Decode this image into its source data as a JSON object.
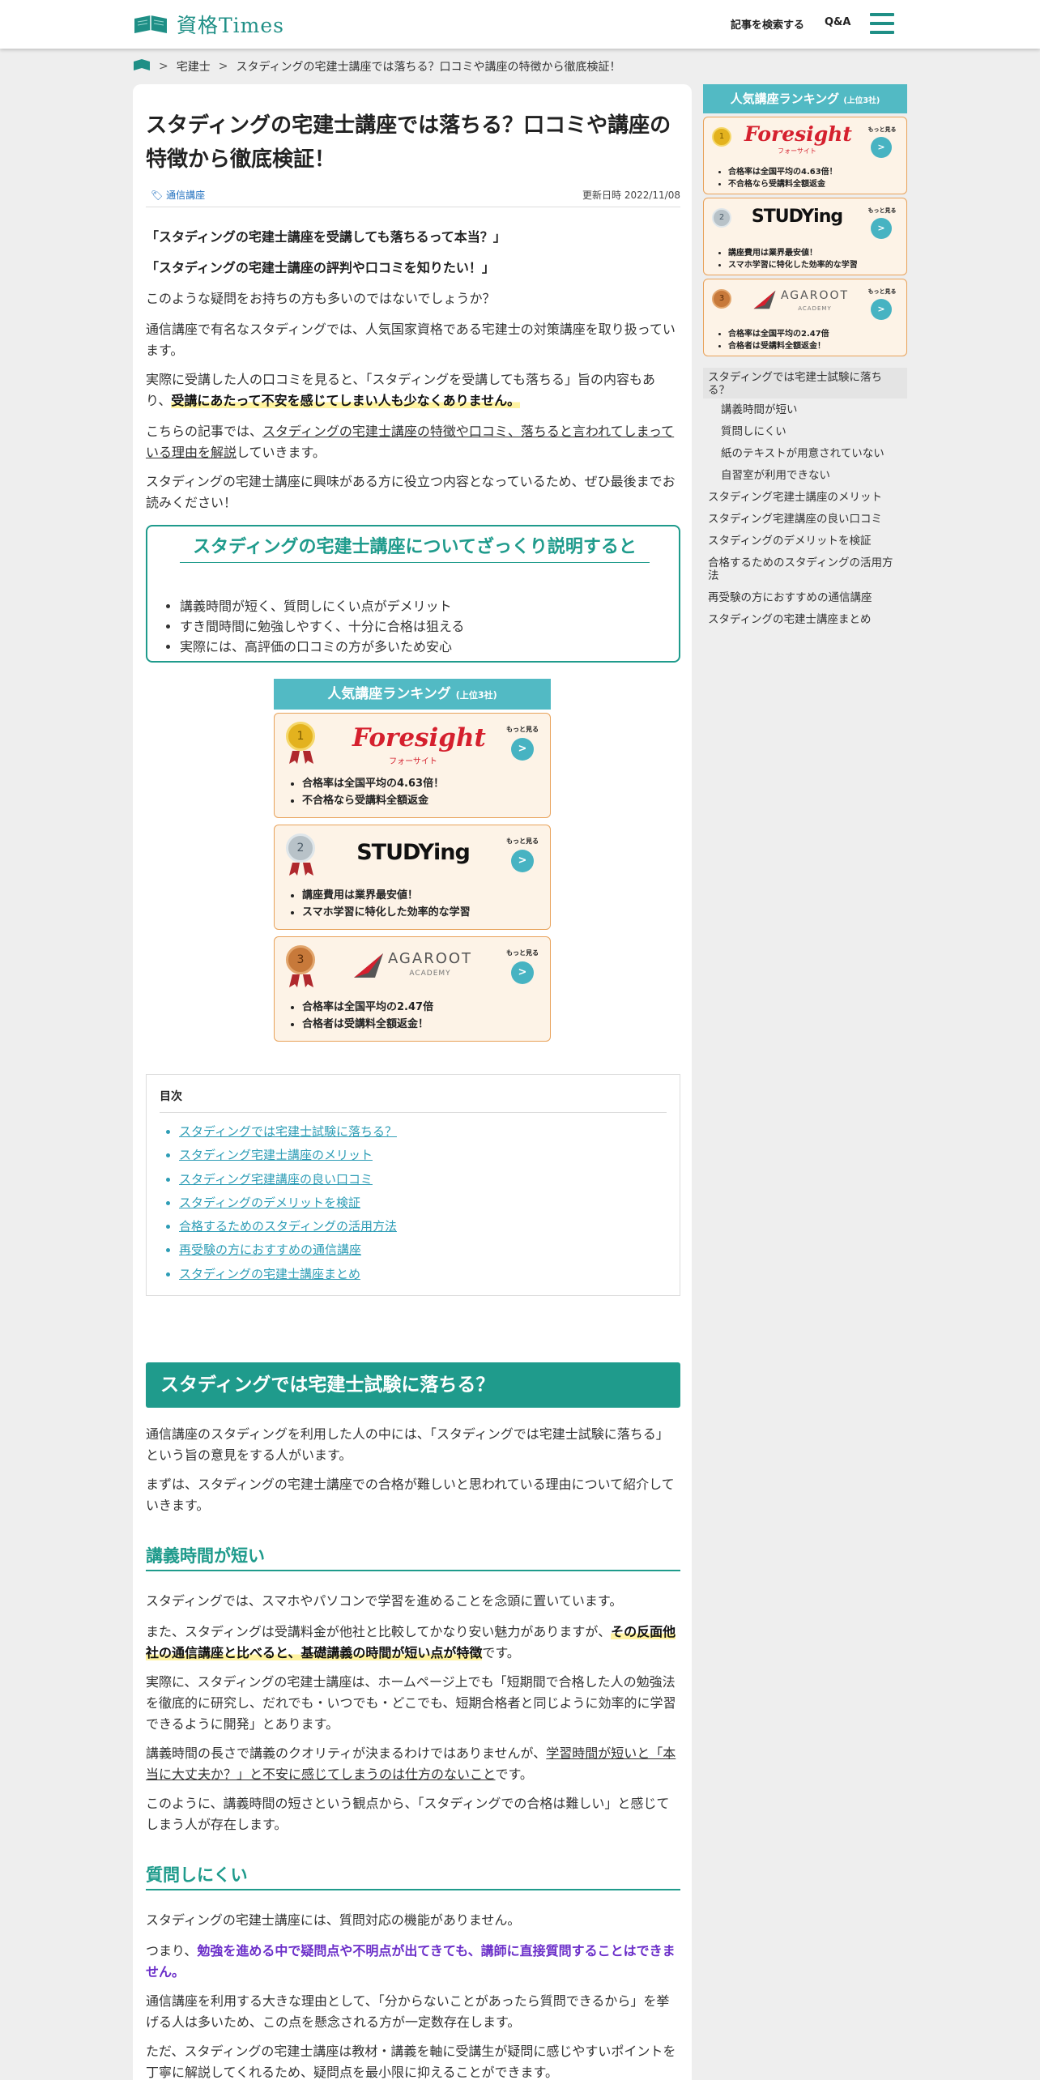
{
  "header": {
    "logo_text": "資格Times",
    "nav_search": "記事を検索する",
    "nav_qa": "Q&A"
  },
  "breadcrumb": {
    "items": [
      "宅建士",
      "スタディングの宅建士講座では落ちる？口コミや講座の特徴から徹底検証！"
    ]
  },
  "article": {
    "title": "スタディングの宅建士講座では落ちる？口コミや講座の特徴から徹底検証！",
    "category": "通信講座",
    "updated": "更新日時 2022/11/08",
    "q1": "「スタディングの宅建士講座を受講しても落ちるって本当？」",
    "q2": "「スタディングの宅建士講座の評判や口コミを知りたい！」",
    "p1": "このような疑問をお持ちの方も多いのではないでしょうか？",
    "p2": "通信講座で有名なスタディングでは、人気国家資格である宅建士の対策講座を取り扱っています。",
    "p3a": "実際に受講した人の口コミを見ると、「スタディングを受講しても落ちる」旨の内容もあり、",
    "p3b": "受講にあたって不安を感じてしまい人も少なくありません。",
    "p4a": "こちらの記事では、",
    "p4b": "スタディングの宅建士講座の特徴や口コミ、落ちると言われてしまっている理由を解説",
    "p4c": "していきます。",
    "p5": "スタディングの宅建士講座に興味がある方に役立つ内容となっているため、ぜひ最後までお読みください！",
    "summary_title": "スタディングの宅建士講座についてざっくり説明すると",
    "summary_items": [
      "講義時間が短く、質問しにくい点がデメリット",
      "すき間時間に勉強しやすく、十分に合格は狙える",
      "実際には、高評価の口コミの方が多いため安心"
    ],
    "toc_title": "目次",
    "toc_items": [
      "スタディングでは宅建士試験に落ちる？",
      "スタディング宅建士講座のメリット",
      "スタディング宅建講座の良い口コミ",
      "スタディングのデメリットを検証",
      "合格するためのスタディングの活用方法",
      "再受験の方におすすめの通信講座",
      "スタディングの宅建士講座まとめ"
    ],
    "h2": "スタディングでは宅建士試験に落ちる？",
    "s1p1": "通信講座のスタディングを利用した人の中には、「スタディングでは宅建士試験に落ちる」という旨の意見をする人がいます。",
    "s1p2": "まずは、スタディングの宅建士講座での合格が難しいと思われている理由について紹介していきます。",
    "h3a": "講義時間が短い",
    "s2p1": "スタディングでは、スマホやパソコンで学習を進めることを念頭に置いています。",
    "s2p2a": "また、スタディングは受講料金が他社と比較してかなり安い魅力がありますが、",
    "s2p2b": "その反面他社の通信講座と比べると、基礎講義の時間が短い点が特徴",
    "s2p2c": "です。",
    "s2p3": "実際に、スタディングの宅建士講座は、ホームページ上でも「短期間で合格した人の勉強法を徹底的に研究し、だれでも・いつでも・どこでも、短期合格者と同じように効率的に学習できるように開発」とあります。",
    "s2p4a": "講義時間の長さで講義のクオリティが決まるわけではありませんが、",
    "s2p4b": "学習時間が短いと「本当に大丈夫か？」と不安に感じてしまうのは仕方のないこと",
    "s2p4c": "です。",
    "s2p5": "このように、講義時間の短さという観点から、「スタディングでの合格は難しい」と感じてしまう人が存在します。",
    "h3b": "質問しにくい",
    "s3p1": "スタディングの宅建士講座には、質問対応の機能がありません。",
    "s3p2a": "つまり、",
    "s3p2b": "勉強を進める中で疑問点や不明点が出てきても、講師に直接質問することはできません。",
    "s3p3": "通信講座を利用する大きな理由として、「分からないことがあったら質問できるから」を挙げる人は多いため、この点を懸念される方が一定数存在します。",
    "s3p4": "ただ、スタディングの宅建士講座は教材・講義を軸に受講生が疑問に感じやすいポイントを丁寧に解説してくれるため、疑問点を最小限に抑えることができます。"
  },
  "ranking": {
    "title": "人気講座ランキング",
    "subtitle": "(上位3社)",
    "more_label": "もっと見る",
    "go_label": ">",
    "items": [
      {
        "rank": "1",
        "brand": "Foresight",
        "brand_sub": "フォーサイト",
        "bullets": [
          "合格率は全国平均の4.63倍！",
          "不合格なら受講料全額返金"
        ]
      },
      {
        "rank": "2",
        "brand": "STUDYing",
        "brand_sub": "",
        "bullets": [
          "講座費用は業界最安値！",
          "スマホ学習に特化した効率的な学習"
        ]
      },
      {
        "rank": "3",
        "brand": "AGAROOT",
        "brand_sub": "ACADEMY",
        "bullets": [
          "合格率は全国平均の2.47倍",
          "合格者は受講料全額返金！"
        ]
      }
    ]
  },
  "sidebar_toc": {
    "items": [
      {
        "label": "スタディングでは宅建士試験に落ちる？",
        "sub": false,
        "active": true
      },
      {
        "label": "講義時間が短い",
        "sub": true
      },
      {
        "label": "質問しにくい",
        "sub": true
      },
      {
        "label": "紙のテキストが用意されていない",
        "sub": true
      },
      {
        "label": "自習室が利用できない",
        "sub": true
      },
      {
        "label": "スタディング宅建士講座のメリット",
        "sub": false
      },
      {
        "label": "スタディング宅建講座の良い口コミ",
        "sub": false
      },
      {
        "label": "スタディングのデメリットを検証",
        "sub": false
      },
      {
        "label": "合格するためのスタディングの活用方法",
        "sub": false
      },
      {
        "label": "再受験の方におすすめの通信講座",
        "sub": false
      },
      {
        "label": "スタディングの宅建士講座まとめ",
        "sub": false
      }
    ]
  },
  "colors": {
    "accent": "#1f9b8c",
    "ranking_head": "#52bac4",
    "rank_bg": "#fdf3e7",
    "rank_border": "#e8a25a",
    "gold": "#e3b21e",
    "silver": "#b8c2c8",
    "bronze": "#c7793a"
  }
}
